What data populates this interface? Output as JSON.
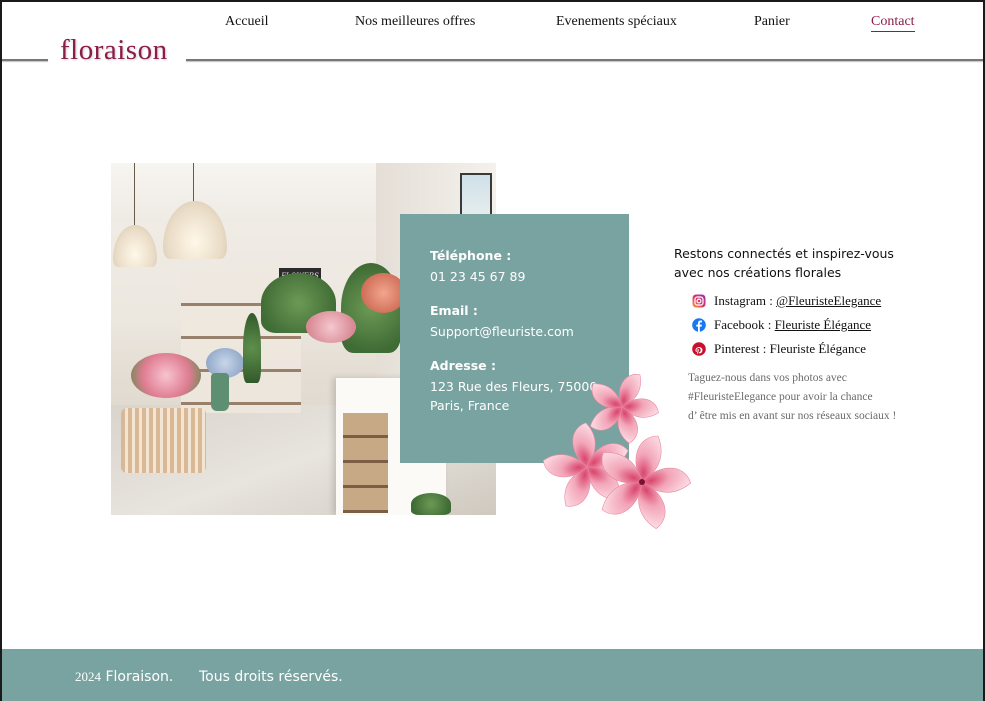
{
  "nav": {
    "items": [
      {
        "label": "Accueil"
      },
      {
        "label": "Nos meilleures offres"
      },
      {
        "label": "Evenements spéciaux"
      },
      {
        "label": "Panier"
      },
      {
        "label": "Contact"
      }
    ],
    "active": "Contact"
  },
  "brand": {
    "logo": "floraison",
    "color": "#8b1d4a"
  },
  "photo": {
    "sign_text": "FLOWERS"
  },
  "contact": {
    "phone_label": "Téléphone :",
    "phone_value": "01 23 45 67 89",
    "email_label": "Email :",
    "email_value": "Support@fleuriste.com",
    "address_label": "Adresse :",
    "address_line1": "123 Rue des Fleurs, 75000",
    "address_line2": "Paris, France",
    "panel_color": "#79a3a1"
  },
  "social": {
    "title_line1": "Restons connectés et inspirez-vous",
    "title_line2": "avec nos créations florales",
    "items": [
      {
        "icon": "instagram-icon",
        "network": "Instagram :",
        "handle": "@FleuristeElegance"
      },
      {
        "icon": "facebook-icon",
        "network": "Facebook :",
        "handle": "Fleuriste Élégance"
      },
      {
        "icon": "pinterest-icon",
        "network": "Pinterest :",
        "handle": "Fleuriste Élégance"
      }
    ],
    "tag_line1": "Taguez-nous dans vos photos avec",
    "tag_line2": "#FleuristeElegance pour avoir la chance",
    "tag_line3": "d’ être mis en avant sur nos réseaux sociaux !"
  },
  "footer": {
    "year": "2024",
    "brand": "Floraison.",
    "rights": "Tous droits réservés."
  }
}
